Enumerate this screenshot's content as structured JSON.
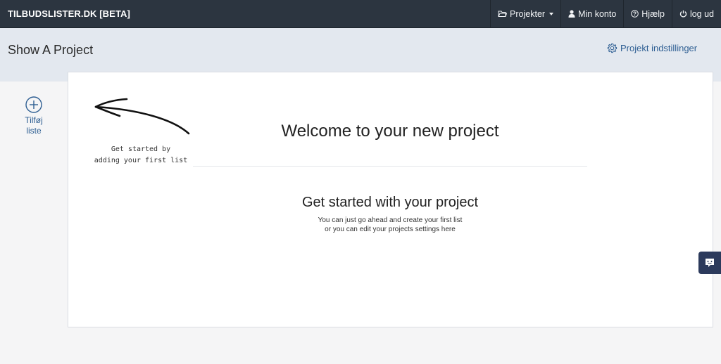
{
  "navbar": {
    "brand": "TILBUDSLISTER.DK [BETA]",
    "items": [
      {
        "label": "Projekter",
        "icon": "folder-icon",
        "dropdown": true
      },
      {
        "label": "Min konto",
        "icon": "user-icon"
      },
      {
        "label": "Hjælp",
        "icon": "question-circle-icon"
      },
      {
        "label": "log ud",
        "icon": "power-icon"
      }
    ]
  },
  "header": {
    "title": "Show A Project",
    "settings_label": "Projekt indstillinger"
  },
  "sidebar": {
    "add_list_label_line1": "Tilføj",
    "add_list_label_line2": "liste"
  },
  "main": {
    "hint_line1": "Get started by",
    "hint_line2": "adding your first list",
    "welcome": "Welcome to your new project",
    "subtitle": "Get started with your project",
    "desc_line1": "You can just go ahead and create your first list",
    "desc_line2": "or you can edit your projects settings here"
  },
  "colors": {
    "navbar_bg": "#2c3540",
    "header_bg": "#e3e8ef",
    "link": "#2f5f93",
    "chat_bg": "#2c3a5c"
  }
}
